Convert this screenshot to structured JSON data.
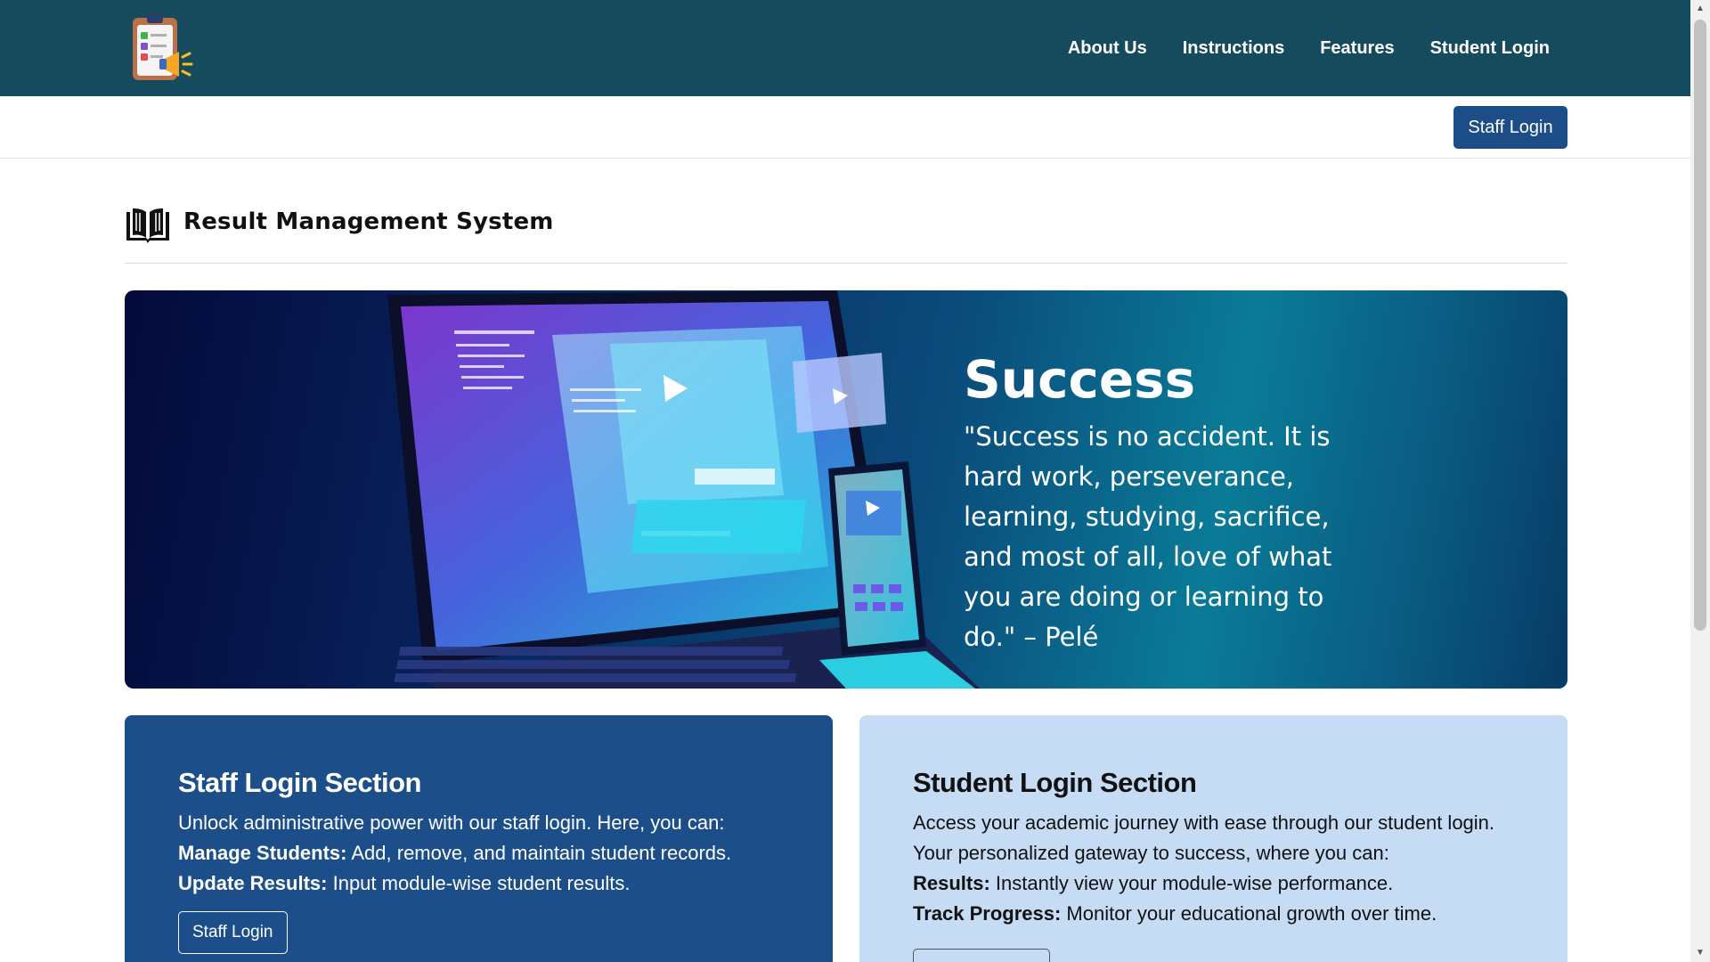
{
  "nav": {
    "items": [
      "About Us",
      "Instructions",
      "Features",
      "Student Login"
    ]
  },
  "subbar": {
    "staff_login": "Staff Login"
  },
  "header": {
    "title": "Result Management System"
  },
  "hero": {
    "title": "Success",
    "quote": "\"Success is no accident. It is hard work, perseverance, learning, studying, sacrifice, and most of all, love of what you are doing or learning to do.\" – Pelé"
  },
  "staff_card": {
    "title": "Staff Login Section",
    "intro": "Unlock administrative power with our staff login. Here, you can:",
    "item1_label": "Manage Students:",
    "item1_text": " Add, remove, and maintain student records.",
    "item2_label": "Update Results:",
    "item2_text": " Input module-wise student results.",
    "button": "Staff Login"
  },
  "student_card": {
    "title": "Student Login Section",
    "intro": "Access your academic journey with ease through our student login. Your personalized gateway to success, where you can:",
    "item1_label": "Results:",
    "item1_text": " Instantly view your module-wise performance.",
    "item2_label": "Track Progress:",
    "item2_text": " Monitor your educational growth over time.",
    "button": ""
  },
  "colors": {
    "nav_bg": "#164b5e",
    "primary_button": "#1c4d87",
    "staff_card_bg": "#1c4f8a",
    "student_card_bg": "#c5dcf4"
  },
  "icons": [
    "clipboard-megaphone-logo",
    "open-book-icon"
  ]
}
